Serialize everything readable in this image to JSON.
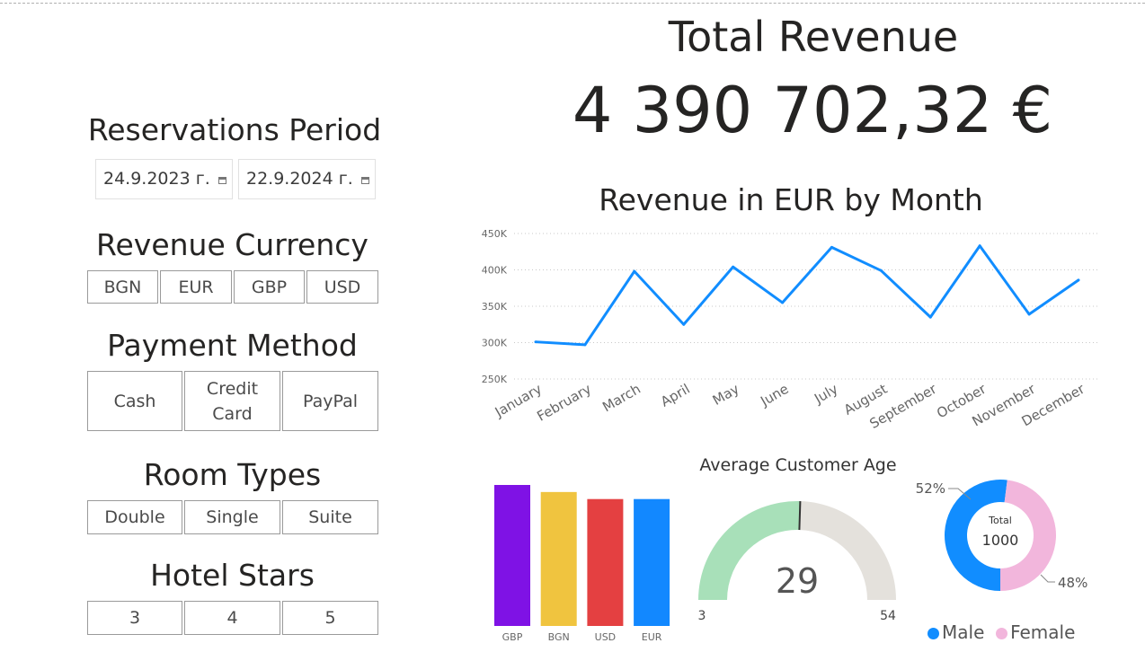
{
  "filters": {
    "reservations_period": {
      "title": "Reservations Period",
      "start_date": "24.9.2023 г.",
      "end_date": "22.9.2024 г."
    },
    "revenue_currency": {
      "title": "Revenue Currency",
      "options": [
        "BGN",
        "EUR",
        "GBP",
        "USD"
      ]
    },
    "payment_method": {
      "title": "Payment Method",
      "options": [
        "Cash",
        "Credit Card",
        "PayPal"
      ]
    },
    "room_types": {
      "title": "Room Types",
      "options": [
        "Double",
        "Single",
        "Suite"
      ]
    },
    "hotel_stars": {
      "title": "Hotel Stars",
      "options": [
        "3",
        "4",
        "5"
      ]
    }
  },
  "kpi": {
    "title": "Total Revenue",
    "value": "4 390 702,32 €"
  },
  "chart_data": [
    {
      "type": "line",
      "title": "Revenue in EUR by Month",
      "categories": [
        "January",
        "February",
        "March",
        "April",
        "May",
        "June",
        "July",
        "August",
        "September",
        "October",
        "November",
        "December"
      ],
      "values": [
        301000,
        297000,
        398000,
        325000,
        404000,
        355000,
        431000,
        399000,
        335000,
        433000,
        339000,
        386000
      ],
      "ylim": [
        250000,
        450000
      ],
      "yticks": [
        "250K",
        "300K",
        "350K",
        "400K",
        "450K"
      ],
      "grid": true,
      "color": "#118dff"
    },
    {
      "type": "bar",
      "categories": [
        "GBP",
        "BGN",
        "USD",
        "EUR"
      ],
      "values": [
        100,
        95,
        90,
        90
      ],
      "colors": [
        "#7f12e5",
        "#f0c43f",
        "#e44041",
        "#1288ff"
      ]
    },
    {
      "type": "gauge",
      "title": "Average Customer Age",
      "value": 29,
      "min": 3,
      "max": 54,
      "colors": {
        "fill": "#a8e0b9",
        "track": "#e4e1dc",
        "needle": "#333333"
      }
    },
    {
      "type": "pie",
      "center_label": "Total",
      "center_value": "1000",
      "categories": [
        "Male",
        "Female"
      ],
      "values": [
        52,
        48
      ],
      "labels": [
        "52%",
        "48%"
      ],
      "colors": [
        "#118dff",
        "#f2b6dc"
      ]
    }
  ]
}
